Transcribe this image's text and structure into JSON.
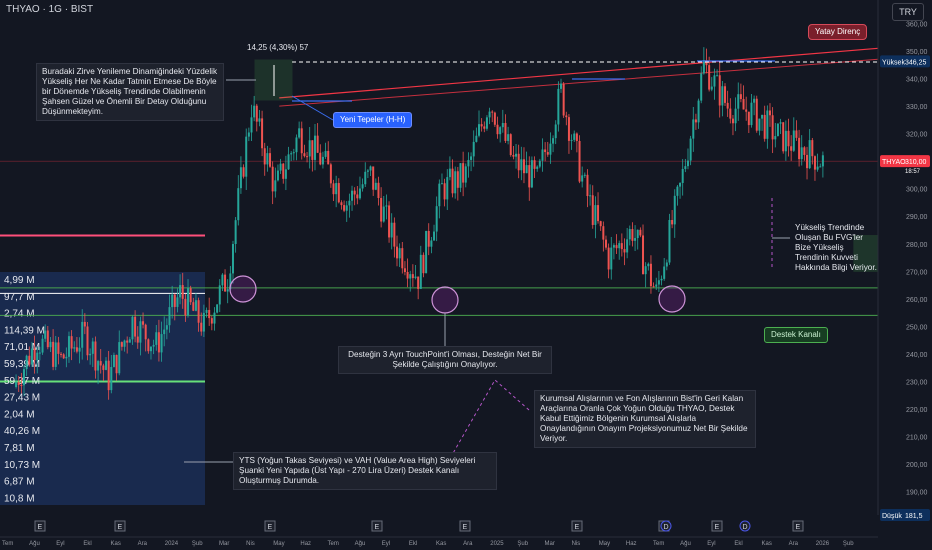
{
  "header": {
    "symbol": "THYAO · 1G · BIST",
    "currency": "TRY"
  },
  "chart_data": {
    "type": "candlestick",
    "x_labels": [
      "Tem",
      "Ağu",
      "Eyl",
      "Ekl",
      "Kas",
      "Ara",
      "2024",
      "Şub",
      "Mar",
      "Nis",
      "May",
      "Haz",
      "Tem",
      "Ağu",
      "Eyl",
      "Ekl",
      "Kas",
      "Ara",
      "2025",
      "Şub",
      "Mar",
      "Nis",
      "May",
      "Haz",
      "Tem",
      "Ağu",
      "Eyl",
      "Ekl",
      "Kas",
      "Ara",
      "2026",
      "Şub"
    ],
    "y_ticks": [
      190,
      200,
      210,
      220,
      230,
      240,
      250,
      260,
      270,
      280,
      290,
      300,
      310,
      320,
      330,
      340,
      350,
      360
    ],
    "ylim": [
      181.5,
      362
    ],
    "price_path": [
      [
        0,
        228
      ],
      [
        1,
        245
      ],
      [
        2,
        238
      ],
      [
        3,
        247
      ],
      [
        4,
        231
      ],
      [
        5,
        252
      ],
      [
        6,
        243
      ],
      [
        7,
        262
      ],
      [
        8,
        250
      ],
      [
        9,
        268
      ],
      [
        10,
        330
      ],
      [
        11,
        300
      ],
      [
        12,
        320
      ],
      [
        13,
        310
      ],
      [
        14,
        295
      ],
      [
        15,
        305
      ],
      [
        16,
        280
      ],
      [
        17,
        268
      ],
      [
        18,
        300
      ],
      [
        19,
        305
      ],
      [
        20,
        332
      ],
      [
        21,
        310
      ],
      [
        22,
        303
      ],
      [
        23,
        335
      ],
      [
        24,
        300
      ],
      [
        25,
        275
      ],
      [
        26,
        285
      ],
      [
        27,
        262
      ],
      [
        28,
        300
      ],
      [
        29,
        345
      ],
      [
        30,
        330
      ],
      [
        31,
        328
      ],
      [
        32,
        320
      ],
      [
        33,
        315
      ],
      [
        34,
        310
      ]
    ],
    "current_price": "310,00",
    "current_timer": "18:57",
    "high_label": "Yüksek",
    "high_value": "346,25",
    "low_label": "Düşük",
    "low_value": "181,5",
    "volume_profile_labels": [
      "4,99 M",
      "97,7 M",
      "2,74 M",
      "114,39 M",
      "71,01 M",
      "59,39 M",
      "59,37 M",
      "27,43 M",
      "2,04 M",
      "40,26 M",
      "7,81 M",
      "10,73 M",
      "6,87 M",
      "10,8 M"
    ],
    "support_levels": [
      264,
      254
    ],
    "resistance_line_points": [
      [
        10,
        333
      ],
      [
        33,
        350
      ]
    ],
    "measure_label": "14,25 (4,30%) 57",
    "fvg_zones": [
      {
        "start": 33,
        "end": 35,
        "top": 307,
        "bottom": 298
      },
      {
        "start": 31,
        "end": 33,
        "top": 283,
        "bottom": 270
      }
    ],
    "event_markers": [
      "E",
      "E",
      "E",
      "E",
      "E",
      "E",
      "E",
      "D",
      "E",
      "D",
      "E"
    ]
  },
  "annotations": {
    "note_top_left": "Buradaki Zirve Yenileme Dinamiğindeki Yüzdelik Yükseliş Her Ne Kadar Tatmin Etmese De Böyle bir Dönemde Yükseliş Trendinde Olabilmenin Şahsen Güzel ve Önemli Bir Detay Olduğunu Düşünmekteyim.",
    "new_peaks": "Yeni Tepeler (H-H)",
    "horizontal_resistance": "Yatay Direnç",
    "fvg_note": "Yükseliş Trendinde Oluşan Bu FVG'ler Bize Yükseliş Trendinin Kuvveti Hakkında Bilgi Veriyor.",
    "support_channel": "Destek Kanalı",
    "touchpoint_note": "Desteğin 3 Ayrı TouchPoint'i Olması, Desteğin Net Bir Şekilde Çalıştığını Onaylıyor.",
    "institutional_note": "Kurumsal Alışlarının ve Fon Alışlarının Bist'in Geri Kalan Araçlarına Oranla Çok Yoğun Olduğu THYAO, Destek Kabul Ettiğimiz Bölgenin Kurumsal Alışlarla Onaylandığının Onayım Projeksiyonumuz Net Bir Şekilde Veriyor.",
    "yts_note": "YTS (Yoğun Takas Seviyesi) ve VAH (Value Area High) Seviyeleri Şuanki Yeni Yapıda (Üst Yapı - 270 Lira Üzeri) Destek Kanalı Oluşturmuş Durumda."
  },
  "colors": {
    "background": "#131722",
    "up": "#26a69a",
    "down": "#ef5350",
    "support": "#4caf50",
    "resistance": "#f23645",
    "price_tag": "#f23645",
    "fvg": "#4caf50",
    "volume_profile": "#1f3a73"
  }
}
